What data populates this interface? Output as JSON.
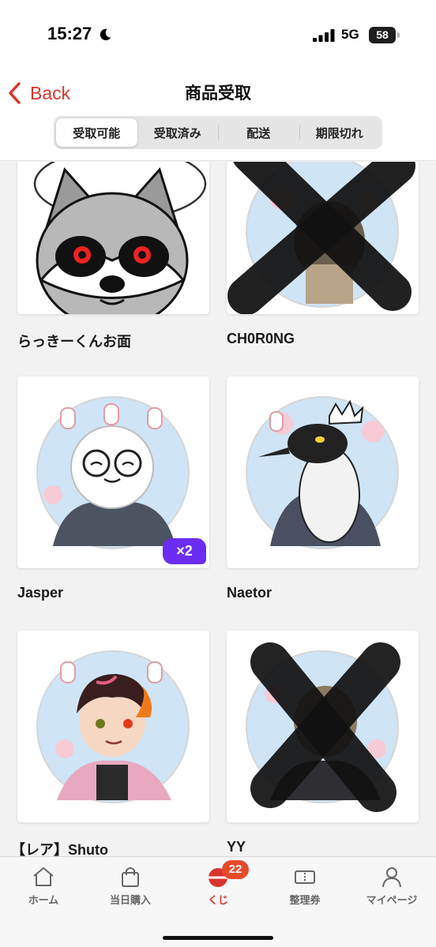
{
  "status_bar": {
    "time": "15:27",
    "network": "5G",
    "battery": "58"
  },
  "nav": {
    "back_label": "Back",
    "title": "商品受取"
  },
  "tabs": [
    {
      "label": "受取可能",
      "active": true
    },
    {
      "label": "受取済み",
      "active": false
    },
    {
      "label": "配送",
      "active": false
    },
    {
      "label": "期限切れ",
      "active": false
    }
  ],
  "items": [
    {
      "name": "らっきーくんお面",
      "image": "raccoon-mask-image",
      "redacted": false
    },
    {
      "name": "CH0R0NG",
      "image": "character-badge-image",
      "redacted": true
    },
    {
      "name": "Jasper",
      "image": "character-badge-image",
      "redacted": false,
      "quantity": "×2"
    },
    {
      "name": "Naetor",
      "image": "penguin-badge-image",
      "redacted": false
    },
    {
      "name": "【レア】Shuto",
      "image": "character-badge-image",
      "redacted": false
    },
    {
      "name": "YY",
      "image": "character-badge-image",
      "redacted": true
    }
  ],
  "tab_bar": [
    {
      "label": "ホーム",
      "icon": "home-icon",
      "active": false
    },
    {
      "label": "当日購入",
      "icon": "shopping-bag-icon",
      "active": false
    },
    {
      "label": "くじ",
      "icon": "lottery-ball-icon",
      "active": true,
      "badge": "22"
    },
    {
      "label": "整理券",
      "icon": "ticket-icon",
      "active": false
    },
    {
      "label": "マイページ",
      "icon": "person-icon",
      "active": false
    }
  ],
  "colors": {
    "accent": "#d9332e",
    "quantity_badge": "#6b2df2",
    "notification_badge": "#e54b2a"
  }
}
